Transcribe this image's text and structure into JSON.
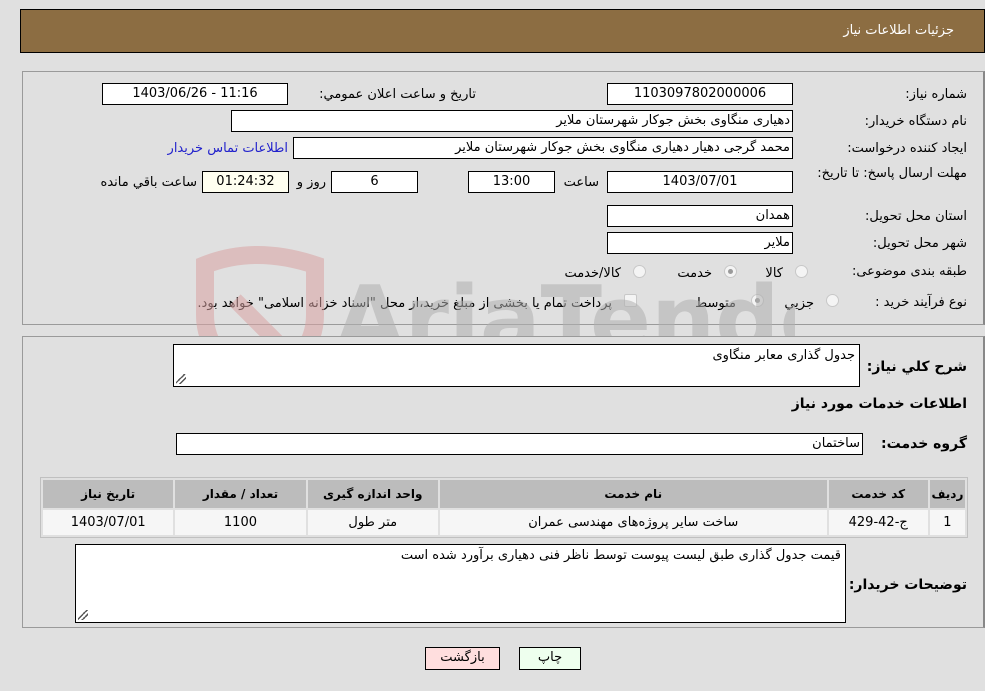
{
  "header": {
    "title": "جزئیات اطلاعات نیاز"
  },
  "form": {
    "need_number": {
      "label": "شماره نیاز:",
      "value": "1103097802000006"
    },
    "announce_datetime": {
      "label": "تاریخ و ساعت اعلان عمومي:",
      "value": "1403/06/26 - 11:16"
    },
    "buyer_org": {
      "label": "نام دستگاه خریدار:",
      "value": "دهیاری منگاوی بخش جوکار شهرستان ملایر"
    },
    "requester": {
      "label": "ایجاد کننده درخواست:",
      "value": "محمد گرجی دهیار دهیاری منگاوی بخش جوکار شهرستان ملایر"
    },
    "buyer_contact_link": "اطلاعات تماس خریدار",
    "deadline": {
      "label": "مهلت ارسال پاسخ: تا تاریخ:",
      "date": "1403/07/01",
      "time_label": "ساعت",
      "time": "13:00",
      "days": "6",
      "days_label": "روز و",
      "remaining": "01:24:32",
      "remaining_label": "ساعت باقي مانده"
    },
    "province": {
      "label": "استان محل تحویل:",
      "value": "همدان"
    },
    "city": {
      "label": "شهر محل تحویل:",
      "value": "ملایر"
    },
    "category": {
      "label": "طبقه بندی موضوعی:",
      "options": [
        "کالا",
        "خدمت",
        "کالا/خدمت"
      ],
      "selected": "خدمت"
    },
    "purchase_type": {
      "label": "نوع فرآیند خرید :",
      "options": [
        "جزيي",
        "متوسط"
      ],
      "selected": "متوسط",
      "treasury_note": "پرداخت تمام یا بخشی از مبلغ خرید،از محل \"اسناد خزانه اسلامی\" خواهد بود.",
      "treasury_checked": false
    }
  },
  "details": {
    "summary_label": "شرح کلي نیاز:",
    "summary_value": "جدول گذاری معابر منگاوی",
    "services_heading": "اطلاعات خدمات مورد نیاز",
    "service_group_label": "گروه خدمت:",
    "service_group_value": "ساختمان",
    "table": {
      "headers": [
        "ردیف",
        "کد خدمت",
        "نام خدمت",
        "واحد اندازه گیری",
        "تعداد / مقدار",
        "تاریخ نیاز"
      ],
      "rows": [
        [
          "1",
          "ج-42-429",
          "ساخت سایر پروژه‌های مهندسی عمران",
          "متر طول",
          "1100",
          "1403/07/01"
        ]
      ]
    },
    "buyer_notes_label": "توضیحات خریدار:",
    "buyer_notes_value": "قیمت جدول گذاری طبق لیست پیوست توسط ناظر فنی دهیاری برآورد شده است"
  },
  "buttons": {
    "print": "چاپ",
    "back": "بازگشت"
  },
  "watermark": {
    "text": "AriaTender.neT",
    "color": "#d9a3a3"
  }
}
